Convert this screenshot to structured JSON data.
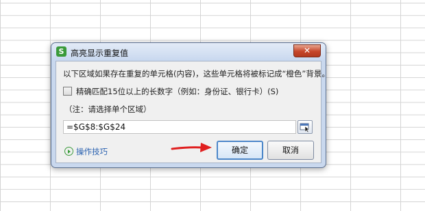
{
  "dialog": {
    "title": "高亮显示重复值",
    "app_icon_letter": "S",
    "close_label": "✕",
    "description": "以下区域如果存在重复的单元格(内容)，这些单元格将被标记成“橙色”背景。",
    "checkbox_label": "精确匹配15位以上的长数字（例如：身份证、银行卡）(S)",
    "checkbox_checked": false,
    "note": "（注：请选择单个区域）",
    "range_value": "=$G$8:$G$24",
    "help_link": "操作技巧",
    "ok_label": "确定",
    "cancel_label": "取消"
  },
  "colors": {
    "accent": "#4b86c9",
    "arrow": "#e02020",
    "link": "#2b62b0",
    "close": "#c6462a"
  },
  "icons": {
    "app": "wps-spreadsheet-icon",
    "range_picker": "range-select-icon",
    "help": "play-circle-icon",
    "annotation": "red-arrow-icon"
  }
}
